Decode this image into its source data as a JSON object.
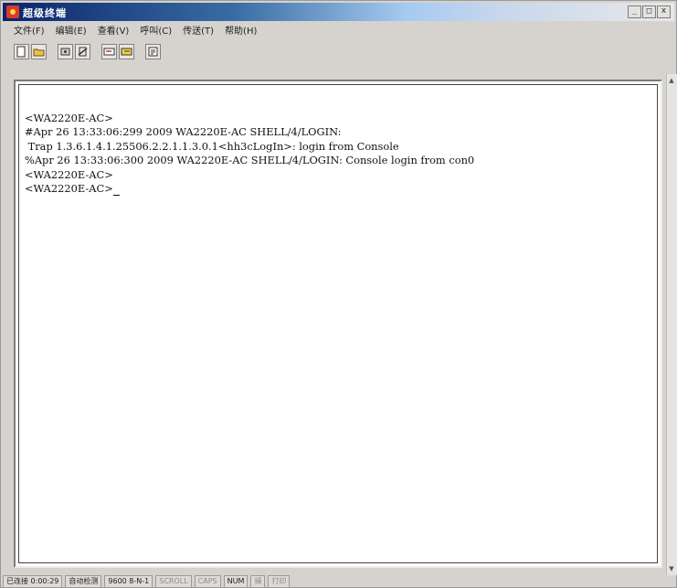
{
  "window": {
    "title": "超级终端",
    "buttons": [
      "_",
      "□",
      "x"
    ]
  },
  "menu": [
    "文件(F)",
    "编辑(E)",
    "查看(V)",
    "呼叫(C)",
    "传送(T)",
    "帮助(H)"
  ],
  "toolbar": {
    "icons": [
      "new-icon",
      "open-icon",
      "dial-icon",
      "disconnect-icon",
      "send-icon",
      "receive-icon",
      "properties-icon"
    ]
  },
  "terminal": {
    "lines": [
      "<WA2220E-AC>",
      "#Apr 26 13:33:06:299 2009 WA2220E-AC SHELL/4/LOGIN:",
      " Trap 1.3.6.1.4.1.25506.2.2.1.1.3.0.1<hh3cLogIn>: login from Console",
      "%Apr 26 13:33:06:300 2009 WA2220E-AC SHELL/4/LOGIN: Console login from con0",
      "<WA2220E-AC>",
      "<WA2220E-AC>"
    ]
  },
  "status": {
    "connected": "已连接 0:00:29",
    "detect": "自动检测",
    "settings": "9600 8-N-1",
    "scroll": "SCROLL",
    "caps": "CAPS",
    "num": "NUM",
    "capture": "捕",
    "echo": "打印"
  }
}
